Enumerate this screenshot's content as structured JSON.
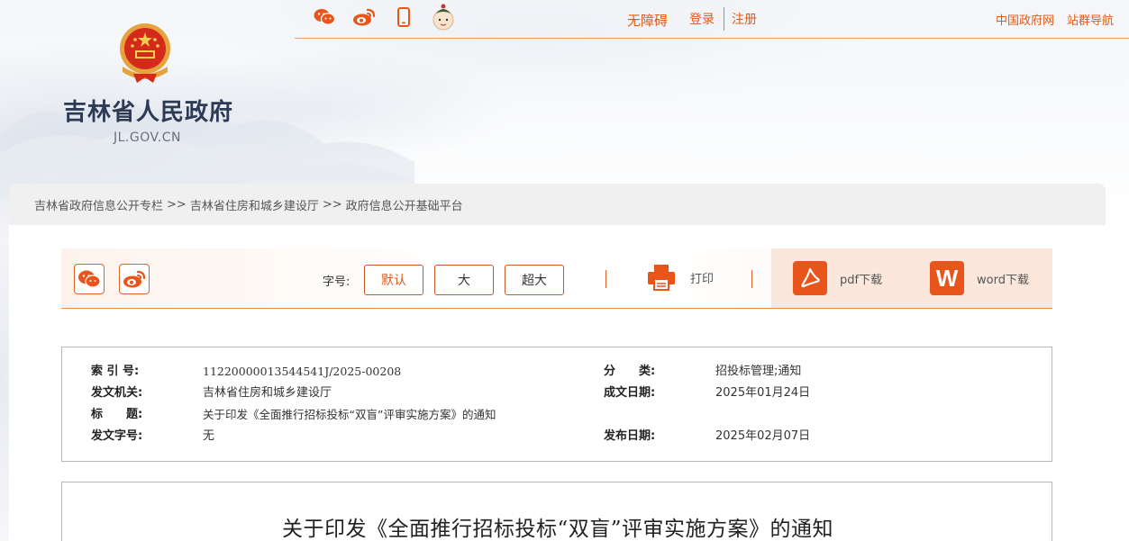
{
  "header": {
    "site_title": "吉林省人民政府",
    "site_domain": "JL.GOV.CN",
    "icons": [
      "wechat-icon",
      "weibo-icon",
      "mobile-icon",
      "assistant-avatar-icon"
    ],
    "accessibility_label": "无障碍",
    "login_label": "登录",
    "register_label": "注册",
    "gov_link": "中国政府网",
    "sitemap_link": "站群导航"
  },
  "breadcrumb": {
    "items": [
      "吉林省政府信息公开专栏",
      "吉林省住房和城乡建设厅",
      "政府信息公开基础平台"
    ],
    "separator": ">>"
  },
  "toolbar": {
    "font_size_label": "字号:",
    "font_options": [
      "默认",
      "大",
      "超大"
    ],
    "selected_font": "默认",
    "print_label": "打印",
    "pdf_label": "pdf下载",
    "word_label": "word下载",
    "word_icon_letter": "W"
  },
  "meta": {
    "index_label": "索 引 号:",
    "index_value": "11220000013544541J/2025-00208",
    "category_label": "分　　类:",
    "category_value": "招投标管理;通知",
    "issuer_label": "发文机关:",
    "issuer_value": "吉林省住房和城乡建设厅",
    "created_label": "成文日期:",
    "created_value": "2025年01月24日",
    "title_label": "标　　题:",
    "title_value": "关于印发《全面推行招标投标“双盲”评审实施方案》的通知",
    "docno_label": "发文字号:",
    "docno_value": "无",
    "published_label": "发布日期:",
    "published_value": "2025年02月07日"
  },
  "article": {
    "title": "关于印发《全面推行招标投标“双盲”评审实施方案》的通知"
  },
  "colors": {
    "accent": "#e05a16",
    "title_blue": "#2d3a55",
    "border": "#b9b9b9"
  }
}
